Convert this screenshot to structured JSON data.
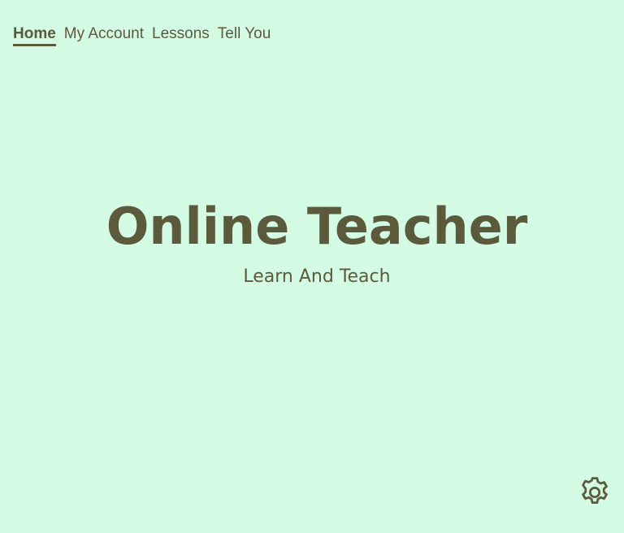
{
  "nav": {
    "items": [
      {
        "label": "Home",
        "active": true
      },
      {
        "label": "My Account",
        "active": false
      },
      {
        "label": "Lessons",
        "active": false
      },
      {
        "label": "Tell You",
        "active": false
      }
    ]
  },
  "hero": {
    "title": "Online Teacher",
    "subtitle": "Learn And Teach"
  },
  "settings": {
    "icon": "gear-icon"
  },
  "colors": {
    "background": "#d4fbe4",
    "text": "#5b5a3d"
  }
}
